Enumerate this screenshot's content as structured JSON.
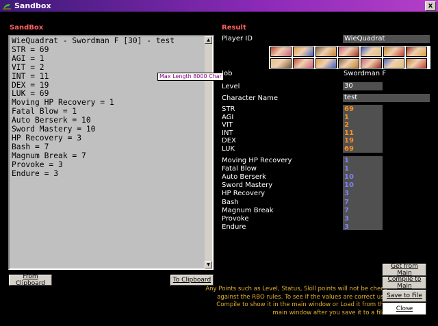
{
  "window": {
    "title": "Sandbox",
    "close_glyph": "x"
  },
  "sandbox": {
    "title": "SandBox",
    "lines": [
      "WieQuadrat - Swordman F [30] - test",
      "STR = 69",
      "AGI = 1",
      "VIT = 2",
      "INT = 11",
      "DEX = 19",
      "LUK = 69",
      "Moving HP Recovery = 1",
      "Fatal Blow = 1",
      "Auto Berserk = 10",
      "Sword Mastery = 10",
      "HP Recovery = 3",
      "Bash = 7",
      "Magnum Break = 7",
      "Provoke = 3",
      "Endure = 3"
    ],
    "tooltip": "Max Length 8000 Char",
    "from_clipboard": "From Clipboard",
    "to_clipboard": "To Clipboard"
  },
  "result": {
    "title": "Result",
    "player_id_label": "Player ID",
    "player_id": "WieQuadrat",
    "job_label": "Job",
    "job": "Swordman F",
    "level_label": "Level",
    "level": "30",
    "char_name_label": "Character Name",
    "char_name": "test",
    "stats": [
      {
        "name": "STR",
        "value": "69"
      },
      {
        "name": "AGI",
        "value": "1"
      },
      {
        "name": "VIT",
        "value": "2"
      },
      {
        "name": "INT",
        "value": "11"
      },
      {
        "name": "DEX",
        "value": "19"
      },
      {
        "name": "LUK",
        "value": "69"
      }
    ],
    "skills": [
      {
        "name": "Moving HP Recovery",
        "value": "1"
      },
      {
        "name": "Fatal Blow",
        "value": "1"
      },
      {
        "name": "Auto Berserk",
        "value": "10"
      },
      {
        "name": "Sword Mastery",
        "value": "10"
      },
      {
        "name": "HP Recovery",
        "value": "3"
      },
      {
        "name": "Bash",
        "value": "7"
      },
      {
        "name": "Magnum Break",
        "value": "7"
      },
      {
        "name": "Provoke",
        "value": "3"
      },
      {
        "name": "Endure",
        "value": "3"
      }
    ]
  },
  "buttons": {
    "get_from_main": "Get from Main",
    "compile_to_main": "Compile to Main",
    "save_to_file": "Save to File",
    "close": "Close"
  },
  "note": "Any Points such as Level, Status, Skill points will not be check against the RBO rules. To see if the values are correct use Compile to show it in the main window or Load it from the main window after you save it to a file.",
  "colors": {
    "section_title": "#ff6060",
    "stat_value": "#ff9020",
    "skill_value": "#8080ff",
    "note": "#e0b030",
    "field_bg": "#505050"
  }
}
